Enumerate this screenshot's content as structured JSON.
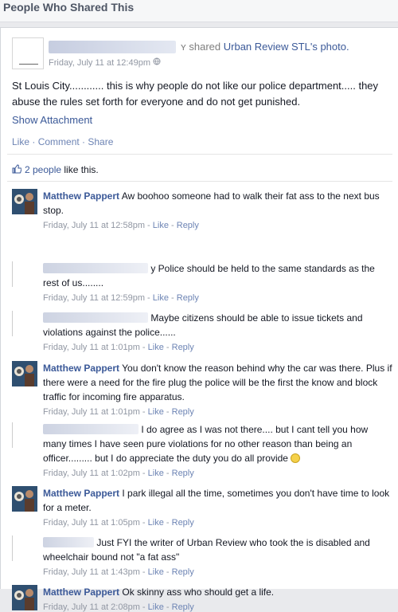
{
  "header": {
    "title": "People Who Shared This"
  },
  "post": {
    "name_partial": "ʏ",
    "shared_text": " shared ",
    "page_name": "Urban Review STL",
    "photo_text": "'s photo.",
    "timestamp": "Friday, July 11 at 12:49pm",
    "body": "St Louis City............ this is why people do not like our police department..... they abuse the rules set forth for everyone and do not get punished.",
    "show_attachment": "Show Attachment",
    "actions": {
      "like": "Like",
      "comment": "Comment",
      "share": "Share",
      "sep": " · "
    }
  },
  "likes": {
    "count_text": "2 people",
    "suffix": " like this."
  },
  "comments": [
    {
      "name": "Matthew Pappert",
      "text": "Aw boohoo someone had to walk their fat ass to the next bus stop.",
      "time": "Friday, July 11 at 12:58pm"
    },
    {
      "name": "",
      "text": "y Police should be held to the same standards as the rest of us........",
      "time": "Friday, July 11 at 12:59pm"
    },
    {
      "name": "",
      "text": "Maybe citizens should be able to issue tickets and violations against the police......",
      "time": "Friday, July 11 at 1:01pm"
    },
    {
      "name": "Matthew Pappert",
      "text": "You don't know the reason behind why the car was there. Plus if there were a need for the fire plug the police will be the first the know and block traffic for incoming fire apparatus.",
      "time": "Friday, July 11 at 1:01pm"
    },
    {
      "name": "",
      "text": "I do agree as I was not there.... but I cant tell you how many times I have seen pure violations for no other reason than being an officer......... but I do appreciate the duty you do all provide",
      "time": "Friday, July 11 at 1:02pm"
    },
    {
      "name": "Matthew Pappert",
      "text": "I park illegal all the time, sometimes you don't have time to look for a meter.",
      "time": "Friday, July 11 at 1:05pm"
    },
    {
      "name": "",
      "text": "Just FYI the writer of Urban Review who took the is disabled and wheelchair bound not \"a fat ass\"",
      "time": "Friday, July 11 at 1:43pm"
    },
    {
      "name": "Matthew Pappert",
      "text": "Ok skinny ass who should get a life.",
      "time": "Friday, July 11 at 2:08pm"
    }
  ],
  "comment_actions": {
    "like": "Like",
    "reply": "Reply",
    "sep": " - "
  },
  "colors": {
    "link": "#3b5998",
    "meta": "#9197a3",
    "action": "#6d84b4"
  },
  "icons": {
    "globe": "globe-icon",
    "thumb": "thumbs-up-icon",
    "smiley": "smiley-icon"
  }
}
